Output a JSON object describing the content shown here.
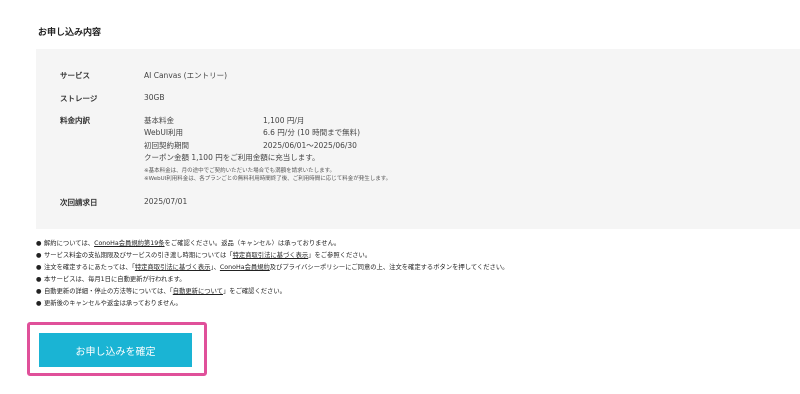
{
  "section_title": "お申し込み内容",
  "summary": {
    "service_label": "サービス",
    "service_value": "AI Canvas (エントリー)",
    "storage_label": "ストレージ",
    "storage_value": "30GB",
    "fee_label": "料金内訳",
    "fees": [
      {
        "name": "基本料金",
        "value": "1,100 円/月"
      },
      {
        "name": "WebUI利用",
        "value": "6.6 円/分 (10 時間まで無料)"
      },
      {
        "name": "初回契約期間",
        "value": "2025/06/01～2025/06/30"
      }
    ],
    "coupon_text": "クーポン金額 1,100 円をご利用金額に充当します。",
    "fine_notes": [
      "※基本料金は、月の途中でご契約いただいた場合でも満額を請求いたします。",
      "※WebUI利用料金は、各プランごとの無料利用時間終了後、ご利用時間に応じて料金が発生します。"
    ],
    "billing_label": "次回請求日",
    "billing_value": "2025/07/01"
  },
  "notes": [
    {
      "pre": "解約については、",
      "link1": "ConoHa会員規約第19条",
      "mid": "をご確認ください。返品（キャンセル）は承っておりません。",
      "link2": "",
      "post": ""
    },
    {
      "pre": "サービス料金の支払期限及びサービスの引き渡し時期については「",
      "link1": "特定商取引法に基づく表示",
      "mid": "」をご参照ください。",
      "link2": "",
      "post": ""
    },
    {
      "pre": "注文を確定するにあたっては、「",
      "link1": "特定商取引法に基づく表示",
      "mid": "」、",
      "link2": "ConoHa会員規約",
      "post": "及びプライバシーポリシーにご同意の上、注文を確定するボタンを押してください。"
    },
    {
      "pre": "本サービスは、毎月1日に自動更新が行われます。",
      "link1": "",
      "mid": "",
      "link2": "",
      "post": ""
    },
    {
      "pre": "自動更新の詳細・停止の方法等については、「",
      "link1": "自動更新について",
      "mid": "」をご確認ください。",
      "link2": "",
      "post": ""
    },
    {
      "pre": "更新後のキャンセルや返金は承っておりません。",
      "link1": "",
      "mid": "",
      "link2": "",
      "post": ""
    }
  ],
  "bullet": "●",
  "confirm_button": "お申し込みを確定",
  "colors": {
    "accent": "#1ab4d4",
    "highlight": "#e0509a",
    "panel": "#f5f5f5"
  }
}
